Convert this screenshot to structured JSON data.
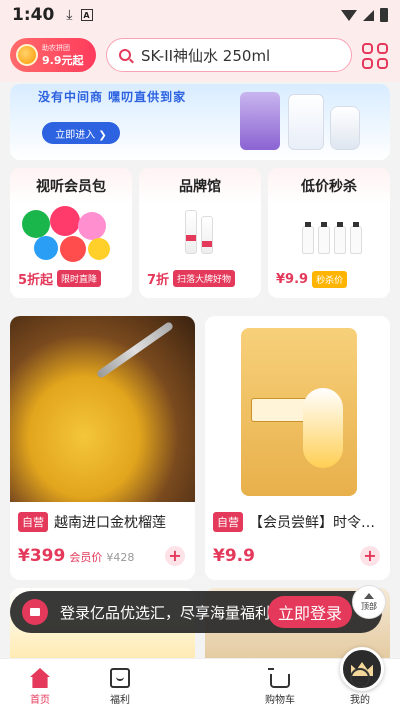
{
  "status_bar": {
    "time": "1:40"
  },
  "header": {
    "promo_line1": "助农拼团",
    "promo_price": "9.9元起",
    "search_placeholder": "SK-II神仙水  250ml"
  },
  "banner": {
    "slogan": "没有中间商  嘿叨直供到家",
    "enter_label": "立即进入 ❯"
  },
  "categories": [
    {
      "title": "视听会员包",
      "num": "5折起",
      "tag": "限时直降",
      "tag_style": "red"
    },
    {
      "title": "品牌馆",
      "num": "7折",
      "tag": "扫落大牌好物",
      "tag_style": "red"
    },
    {
      "title": "低价秒杀",
      "num": "¥9.9",
      "tag": "秒杀价",
      "tag_style": "yellow"
    }
  ],
  "products": [
    {
      "badge": "自营",
      "name": "越南进口金枕榴莲",
      "price": "¥399",
      "member_label": "会员价",
      "original": "¥428"
    },
    {
      "badge": "自营",
      "name": "【会员尝鲜】时令香稻米",
      "price": "¥9.9"
    }
  ],
  "login_bar": {
    "message": "登录亿品优选汇，尽享海量福利",
    "button": "立即登录"
  },
  "to_top_label": "顶部",
  "bottom_nav": [
    {
      "label": "首页",
      "icon": "home-icon",
      "active": true
    },
    {
      "label": "福利",
      "icon": "gift-bag-icon"
    },
    {
      "label": "",
      "icon": "crown-icon"
    },
    {
      "label": "购物车",
      "icon": "cart-icon"
    },
    {
      "label": "我的",
      "icon": "profile-icon"
    }
  ],
  "colors": {
    "accent": "#e4395a",
    "banner_blue": "#2d62e0"
  }
}
